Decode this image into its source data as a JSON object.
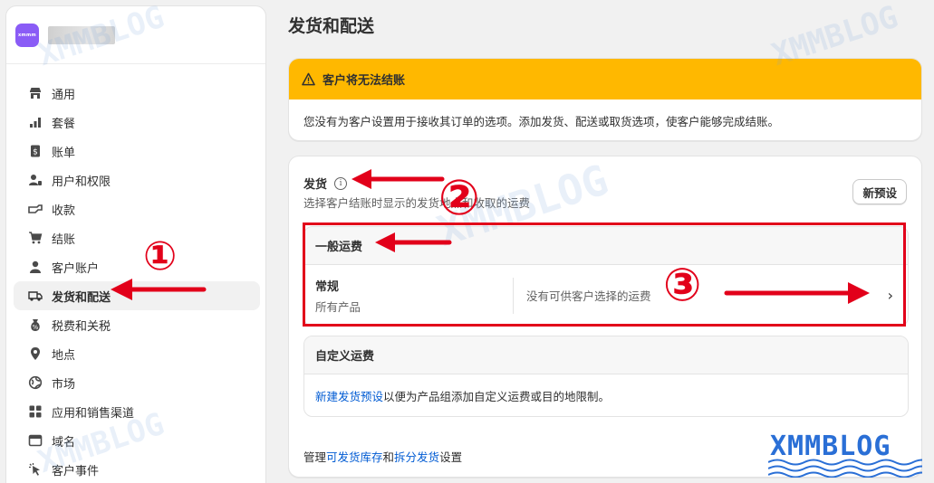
{
  "sidebar": {
    "store_logo_text": "xmmm",
    "items": [
      {
        "label": "通用",
        "icon": "store-icon"
      },
      {
        "label": "套餐",
        "icon": "plan-icon"
      },
      {
        "label": "账单",
        "icon": "billing-icon"
      },
      {
        "label": "用户和权限",
        "icon": "users-icon"
      },
      {
        "label": "收款",
        "icon": "payments-icon"
      },
      {
        "label": "结账",
        "icon": "cart-icon"
      },
      {
        "label": "客户账户",
        "icon": "person-icon"
      },
      {
        "label": "发货和配送",
        "icon": "truck-icon",
        "active": true
      },
      {
        "label": "税费和关税",
        "icon": "tax-icon"
      },
      {
        "label": "地点",
        "icon": "location-icon"
      },
      {
        "label": "市场",
        "icon": "globe-icon"
      },
      {
        "label": "应用和销售渠道",
        "icon": "apps-icon"
      },
      {
        "label": "域名",
        "icon": "domain-icon"
      },
      {
        "label": "客户事件",
        "icon": "cursor-icon"
      }
    ]
  },
  "page": {
    "title": "发货和配送"
  },
  "warning": {
    "title": "客户将无法结账",
    "body": "您没有为客户设置用于接收其订单的选项。添加发货、配送或取货选项，使客户能够完成结账。",
    "color": "#ffb800"
  },
  "shipping": {
    "title": "发货",
    "info_symbol": "i",
    "subtitle": "选择客户结账时显示的发货地点和收取的运费",
    "new_preset_button": "新预设",
    "general_rates": {
      "heading": "一般运费",
      "rate_name": "常规",
      "rate_scope": "所有产品",
      "rate_status": "没有可供客户选择的运费",
      "chevron": "›"
    },
    "custom_rates": {
      "heading": "自定义运费",
      "link_text": "新建发货预设",
      "rest_text": "以便为产品组添加自定义运费或目的地限制。"
    },
    "footer": {
      "prefix": "管理",
      "link1": "可发货库存",
      "middle": "和",
      "link2": "拆分发货",
      "suffix": "设置"
    }
  },
  "annotations": {
    "num1": "①",
    "num2": "②",
    "num3": "③",
    "color": "#e2001a"
  },
  "watermark": {
    "text": "XMMBLOG"
  }
}
